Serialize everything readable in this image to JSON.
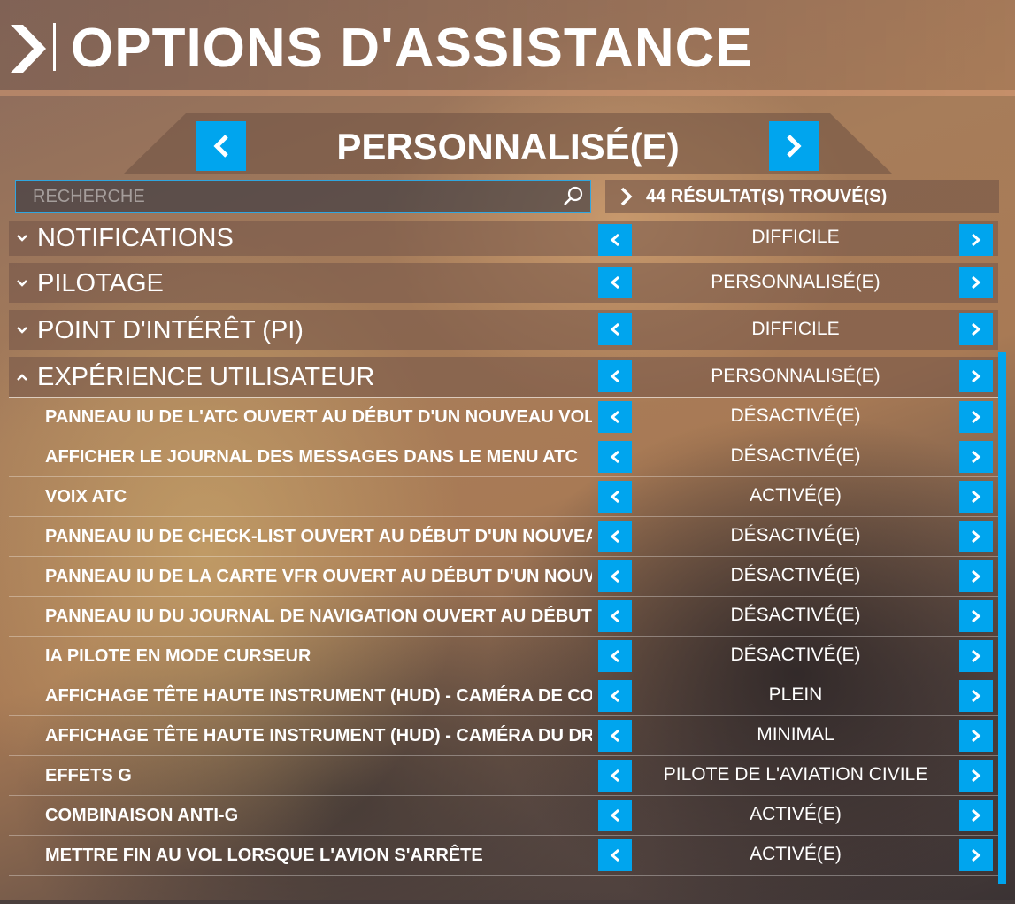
{
  "header": {
    "title": "OPTIONS D'ASSISTANCE"
  },
  "preset": {
    "title": "PERSONNALISÉ(E)"
  },
  "search": {
    "placeholder": "RECHERCHE"
  },
  "results": {
    "text": "44 RÉSULTAT(S) TROUVÉ(S)"
  },
  "categories": [
    {
      "label": "NOTIFICATIONS",
      "value": "DIFFICILE",
      "expanded": false
    },
    {
      "label": "PILOTAGE",
      "value": "PERSONNALISÉ(E)",
      "expanded": false
    },
    {
      "label": "POINT D'INTÉRÊT (PI)",
      "value": "DIFFICILE",
      "expanded": false
    },
    {
      "label": "EXPÉRIENCE UTILISATEUR",
      "value": "PERSONNALISÉ(E)",
      "expanded": true
    }
  ],
  "options": [
    {
      "label": "PANNEAU IU DE L'ATC OUVERT AU DÉBUT D'UN NOUVEAU VOL",
      "value": "DÉSACTIVÉ(E)"
    },
    {
      "label": "AFFICHER LE JOURNAL DES MESSAGES DANS LE MENU ATC",
      "value": "DÉSACTIVÉ(E)"
    },
    {
      "label": "VOIX ATC",
      "value": "ACTIVÉ(E)"
    },
    {
      "label": "PANNEAU IU DE CHECK-LIST OUVERT AU DÉBUT D'UN NOUVEAU VOL",
      "value": "DÉSACTIVÉ(E)"
    },
    {
      "label": "PANNEAU IU DE LA CARTE VFR OUVERT AU DÉBUT D'UN NOUVEAU VOL",
      "value": "DÉSACTIVÉ(E)"
    },
    {
      "label": "PANNEAU IU DU JOURNAL DE NAVIGATION OUVERT AU DÉBUT D'UN NOUVEAU VOL",
      "value": "DÉSACTIVÉ(E)"
    },
    {
      "label": "IA PILOTE EN MODE CURSEUR",
      "value": "DÉSACTIVÉ(E)"
    },
    {
      "label": "AFFICHAGE TÊTE HAUTE INSTRUMENT (HUD) - CAMÉRA DE COCKPIT",
      "value": "PLEIN"
    },
    {
      "label": "AFFICHAGE TÊTE HAUTE INSTRUMENT (HUD) - CAMÉRA DU DRONE",
      "value": "MINIMAL"
    },
    {
      "label": "EFFETS G",
      "value": "PILOTE DE L'AVIATION CIVILE"
    },
    {
      "label": "COMBINAISON ANTI-G",
      "value": "ACTIVÉ(E)"
    },
    {
      "label": "METTRE FIN AU VOL LORSQUE L'AVION S'ARRÊTE",
      "value": "ACTIVÉ(E)"
    }
  ],
  "colors": {
    "accent": "#00a5ee"
  }
}
